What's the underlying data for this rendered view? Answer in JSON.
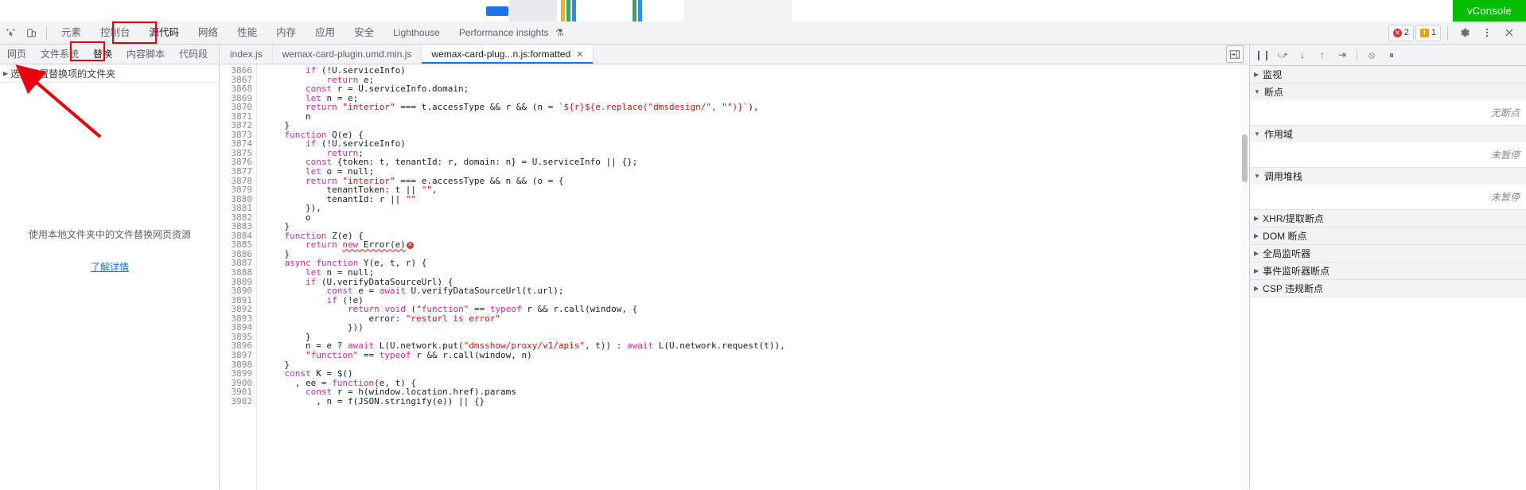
{
  "browser": {
    "vconsole_label": "vConsole",
    "vconsole_color": "#04be02"
  },
  "devtools": {
    "toolbar": {
      "inspect_icon": "inspect-element-icon",
      "device_icon": "device-toolbar-icon",
      "panels": [
        {
          "label": "元素",
          "active": false
        },
        {
          "label": "控制台",
          "active": false
        },
        {
          "label": "源代码",
          "active": true
        },
        {
          "label": "网络",
          "active": false
        },
        {
          "label": "性能",
          "active": false
        },
        {
          "label": "内存",
          "active": false
        },
        {
          "label": "应用",
          "active": false
        },
        {
          "label": "安全",
          "active": false
        },
        {
          "label": "Lighthouse",
          "active": false
        },
        {
          "label": "Performance insights",
          "active": false
        }
      ],
      "perf_insights_badge": "⚗",
      "error_count": "2",
      "warning_count": "1",
      "settings_icon": "gear-icon",
      "more_icon": "more-vertical-icon",
      "close_icon": "close-icon"
    },
    "navigator": {
      "tabs": [
        {
          "label": "网页",
          "active": false
        },
        {
          "label": "文件系统",
          "active": false
        },
        {
          "label": "替换",
          "active": true
        },
        {
          "label": "内容脚本",
          "active": false
        },
        {
          "label": "代码段",
          "active": false
        }
      ],
      "more_icon": "more-vertical-icon",
      "select_folder_label": "选择放置替换项的文件夹",
      "empty_text": "使用本地文件夹中的文件替换网页资源",
      "learn_more": "了解详情"
    },
    "editor": {
      "tabs": [
        {
          "label": "index.js",
          "active": false,
          "closable": false
        },
        {
          "label": "wemax-card-plugin.umd.min.js",
          "active": false,
          "closable": false
        },
        {
          "label": "wemax-card-plug...n.js:formatted",
          "active": true,
          "closable": true
        }
      ],
      "close_glyph": "✕",
      "show_navigator_icon": "show-navigator-icon",
      "first_line_number": 3866,
      "lines": [
        {
          "n": 3866,
          "t": "        if (!U.serviceInfo)"
        },
        {
          "n": 3867,
          "t": "            return e;"
        },
        {
          "n": 3868,
          "t": "        const r = U.serviceInfo.domain;"
        },
        {
          "n": 3869,
          "t": "        let n = e;"
        },
        {
          "n": 3870,
          "t": "        return \"interior\" === t.accessType && r && (n = `${r}${e.replace(\"dmsdesign/\", \"\")}`),"
        },
        {
          "n": 3871,
          "t": "        n"
        },
        {
          "n": 3872,
          "t": "    }"
        },
        {
          "n": 3873,
          "t": "    function Q(e) {"
        },
        {
          "n": 3874,
          "t": "        if (!U.serviceInfo)"
        },
        {
          "n": 3875,
          "t": "            return;"
        },
        {
          "n": 3876,
          "t": "        const {token: t, tenantId: r, domain: n} = U.serviceInfo || {};"
        },
        {
          "n": 3877,
          "t": "        let o = null;"
        },
        {
          "n": 3878,
          "t": "        return \"interior\" === e.accessType && n && (o = {"
        },
        {
          "n": 3879,
          "t": "            tenantToken: t || \"\","
        },
        {
          "n": 3880,
          "t": "            tenantId: r || \"\""
        },
        {
          "n": 3881,
          "t": "        }),"
        },
        {
          "n": 3882,
          "t": "        o"
        },
        {
          "n": 3883,
          "t": "    }"
        },
        {
          "n": 3884,
          "t": "    function Z(e) {"
        },
        {
          "n": 3885,
          "t": "        return new Error(e)"
        },
        {
          "n": 3886,
          "t": "    }"
        },
        {
          "n": 3887,
          "t": "    async function Y(e, t, r) {"
        },
        {
          "n": 3888,
          "t": "        let n = null;"
        },
        {
          "n": 3889,
          "t": "        if (U.verifyDataSourceUrl) {"
        },
        {
          "n": 3890,
          "t": "            const e = await U.verifyDataSourceUrl(t.url);"
        },
        {
          "n": 3891,
          "t": "            if (!e)"
        },
        {
          "n": 3892,
          "t": "                return void (\"function\" == typeof r && r.call(window, {"
        },
        {
          "n": 3893,
          "t": "                    error: \"resturl is error\""
        },
        {
          "n": 3894,
          "t": "                }))"
        },
        {
          "n": 3895,
          "t": "        }"
        },
        {
          "n": 3896,
          "t": "        n = e ? await L(U.network.put(\"dmsshow/proxy/v1/apis\", t)) : await L(U.network.request(t)),"
        },
        {
          "n": 3897,
          "t": "        \"function\" == typeof r && r.call(window, n)"
        },
        {
          "n": 3898,
          "t": "    }"
        },
        {
          "n": 3899,
          "t": "    const K = $()"
        },
        {
          "n": 3900,
          "t": "      , ee = function(e, t) {"
        },
        {
          "n": 3901,
          "t": "        const r = h(window.location.href).params"
        },
        {
          "n": 3902,
          "t": "          , n = f(JSON.stringify(e)) || {}"
        }
      ],
      "error_line": 3885,
      "error_badge_glyph": "✕"
    },
    "debugger": {
      "controls": [
        {
          "name": "pause-resume-button",
          "glyph": "❙❙"
        },
        {
          "name": "step-over-button",
          "glyph": "⤻"
        },
        {
          "name": "step-into-button",
          "glyph": "↓"
        },
        {
          "name": "step-out-button",
          "glyph": "↑"
        },
        {
          "name": "step-button",
          "glyph": "⇥"
        },
        {
          "name": "deactivate-breakpoints-button",
          "glyph": "⦸"
        },
        {
          "name": "pause-on-exceptions-button",
          "glyph": "⏸"
        }
      ],
      "sections": [
        {
          "label": "监视",
          "expanded": false,
          "body": ""
        },
        {
          "label": "断点",
          "expanded": true,
          "body": "无断点"
        },
        {
          "label": "作用域",
          "expanded": true,
          "body": "未暂停"
        },
        {
          "label": "调用堆栈",
          "expanded": true,
          "body": "未暂停"
        },
        {
          "label": "XHR/提取断点",
          "expanded": false,
          "body": ""
        },
        {
          "label": "DOM 断点",
          "expanded": false,
          "body": ""
        },
        {
          "label": "全局监听器",
          "expanded": false,
          "body": ""
        },
        {
          "label": "事件监听器断点",
          "expanded": false,
          "body": ""
        },
        {
          "label": "CSP 违规断点",
          "expanded": false,
          "body": ""
        }
      ],
      "expanded_glyph": "▼",
      "collapsed_glyph": "▶"
    }
  },
  "annotations": {
    "highlight_color": "#e8000c",
    "boxes": [
      "源代码",
      "替换"
    ],
    "arrow_target": "选择放置替换项的文件夹"
  }
}
